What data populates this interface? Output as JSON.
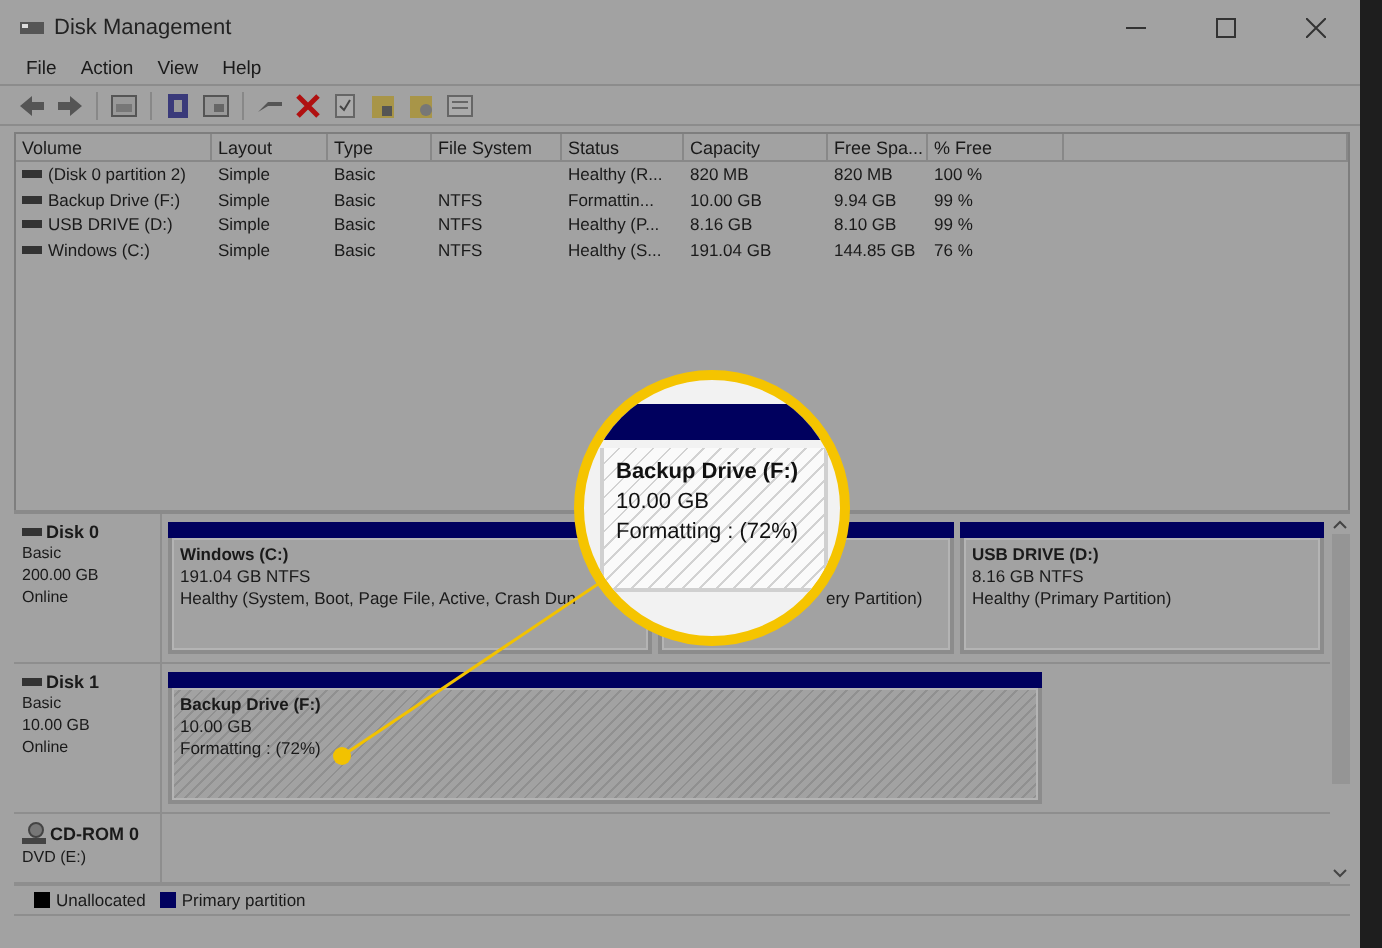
{
  "window": {
    "title": "Disk Management"
  },
  "menu": [
    "File",
    "Action",
    "View",
    "Help"
  ],
  "volumes": {
    "columns": [
      "Volume",
      "Layout",
      "Type",
      "File System",
      "Status",
      "Capacity",
      "Free Spa...",
      "% Free"
    ],
    "rows": [
      {
        "cells": [
          "(Disk 0 partition 2)",
          "Simple",
          "Basic",
          "",
          "Healthy (R...",
          "820 MB",
          "820 MB",
          "100 %"
        ]
      },
      {
        "cells": [
          "Backup Drive (F:)",
          "Simple",
          "Basic",
          "NTFS",
          "Formattin...",
          "10.00 GB",
          "9.94 GB",
          "99 %"
        ]
      },
      {
        "cells": [
          "USB DRIVE (D:)",
          "Simple",
          "Basic",
          "NTFS",
          "Healthy (P...",
          "8.16 GB",
          "8.10 GB",
          "99 %"
        ]
      },
      {
        "cells": [
          "Windows (C:)",
          "Simple",
          "Basic",
          "NTFS",
          "Healthy (S...",
          "191.04 GB",
          "144.85 GB",
          "76 %"
        ]
      }
    ]
  },
  "disks": [
    {
      "kind": "disk",
      "name": "Disk 0",
      "type": "Basic",
      "size": "200.00 GB",
      "status": "Online",
      "partitions": [
        {
          "kind": "primary",
          "title": "Windows  (C:)",
          "size": "191.04 GB NTFS",
          "status": "Healthy (System, Boot, Page File, Active, Crash Dun"
        },
        {
          "kind": "primary",
          "status": "ery Partition)"
        },
        {
          "kind": "primary",
          "title": "USB DRIVE  (D:)",
          "size": "8.16 GB NTFS",
          "status": "Healthy (Primary Partition)"
        }
      ]
    },
    {
      "kind": "disk",
      "name": "Disk 1",
      "type": "Basic",
      "size": "10.00 GB",
      "status": "Online",
      "partitions": [
        {
          "kind": "formatting",
          "title": "Backup Drive  (F:)",
          "size": "10.00 GB",
          "status": "Formatting : (72%)"
        }
      ]
    },
    {
      "kind": "cdrom",
      "name": "CD-ROM 0",
      "type": "DVD (E:)"
    }
  ],
  "legend": [
    {
      "label": "Unallocated",
      "color": "#000000"
    },
    {
      "label": "Primary partition",
      "color": "#00005e"
    }
  ],
  "callout": {
    "title": "Backup Drive  (F:)",
    "size": "10.00 GB",
    "status": "Formatting : (72%)"
  }
}
